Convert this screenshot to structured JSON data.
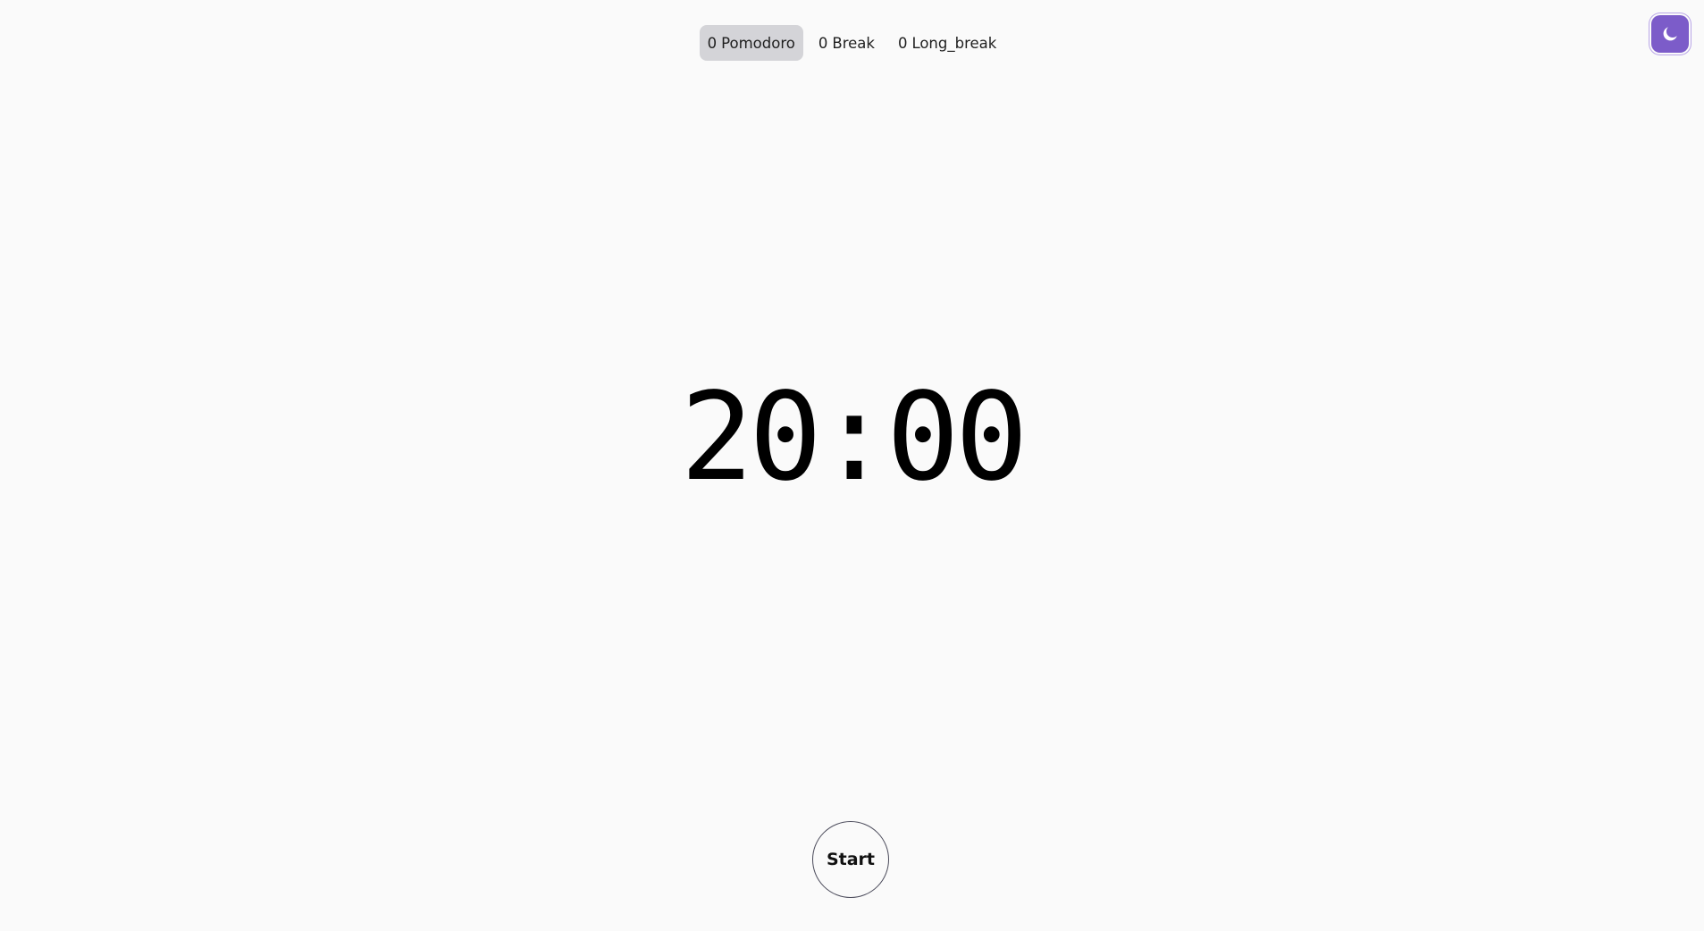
{
  "tabs": [
    {
      "count": "0",
      "label": "Pomodoro",
      "active": true
    },
    {
      "count": "0",
      "label": "Break",
      "active": false
    },
    {
      "count": "0",
      "label": "Long_break",
      "active": false
    }
  ],
  "timer": {
    "display": "20:00"
  },
  "controls": {
    "start_label": "Start"
  },
  "theme_toggle": {
    "icon": "moon-icon"
  },
  "colors": {
    "background": "#fafafa",
    "active_tab": "#d4d4d8",
    "accent": "#7c5cc9"
  }
}
